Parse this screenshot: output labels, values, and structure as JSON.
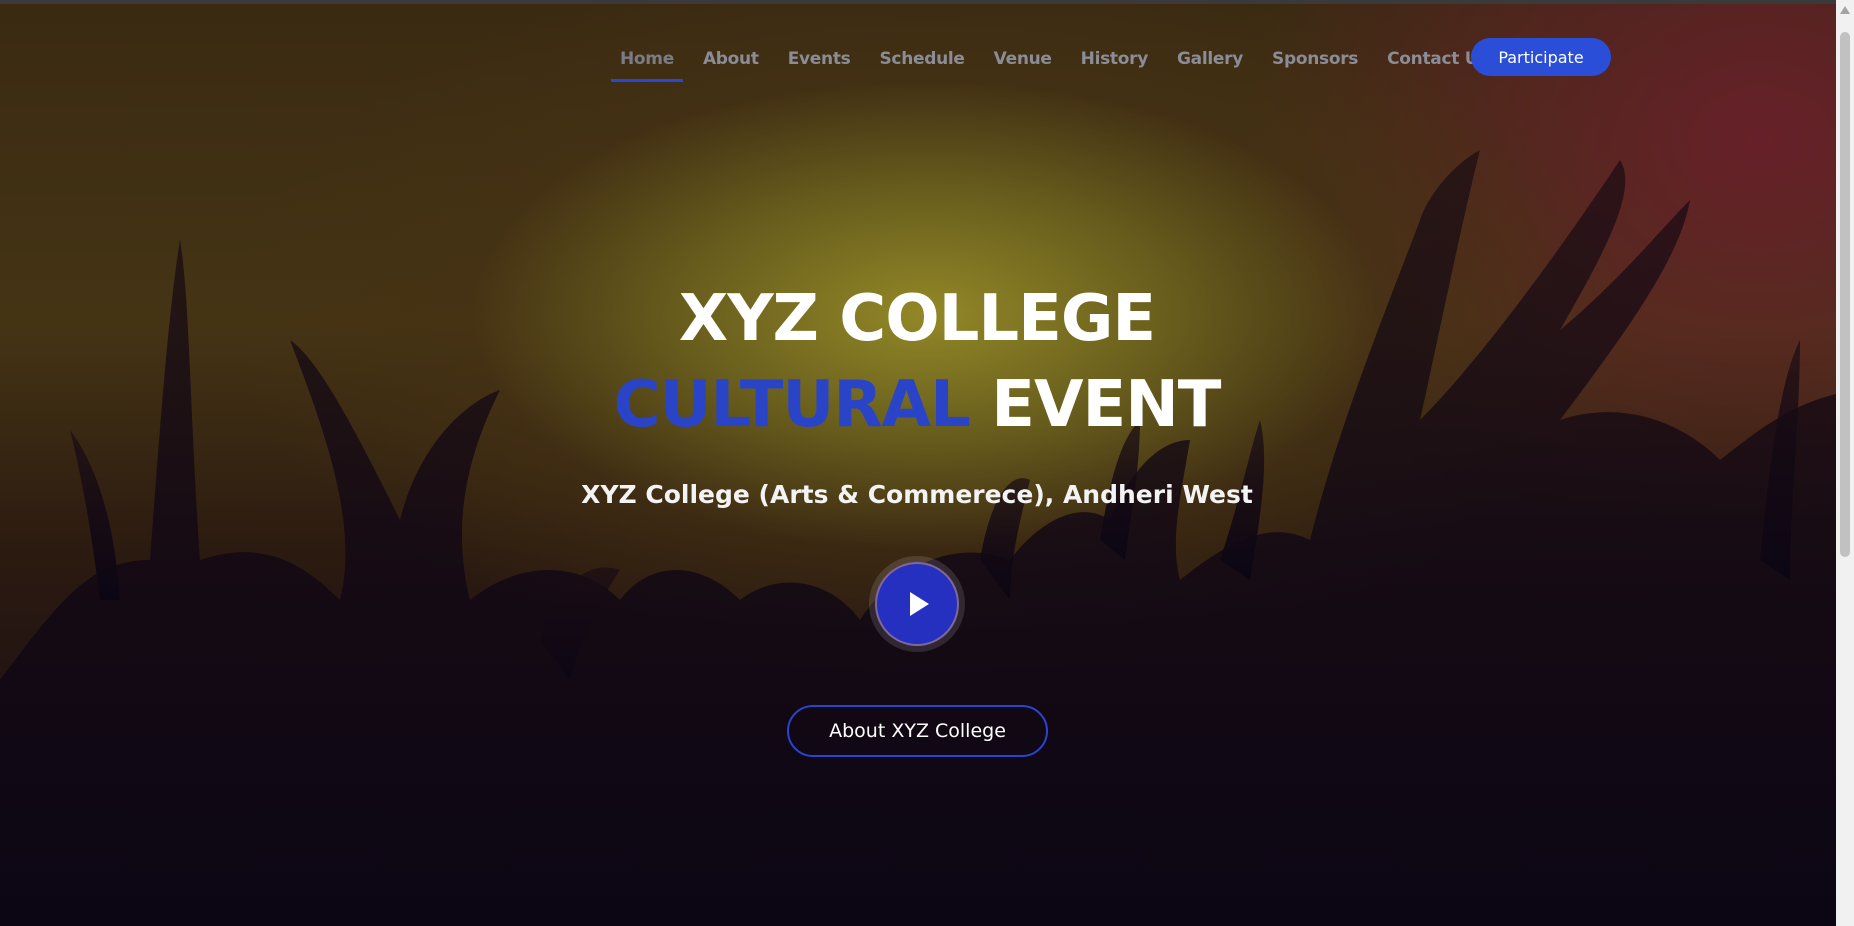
{
  "nav": {
    "items": [
      {
        "label": "Home",
        "active": true
      },
      {
        "label": "About"
      },
      {
        "label": "Events"
      },
      {
        "label": "Schedule"
      },
      {
        "label": "Venue"
      },
      {
        "label": "History"
      },
      {
        "label": "Gallery"
      },
      {
        "label": "Sponsors"
      },
      {
        "label": "Contact Us"
      }
    ],
    "cta_label": "Participate"
  },
  "hero": {
    "title_line1": "XYZ COLLEGE",
    "title_line2_accent": "CULTURAL",
    "title_line2_rest": "EVENT",
    "subtitle": "XYZ College (Arts & Commerece), Andheri West",
    "play_icon": "play-icon",
    "about_button_label": "About XYZ College"
  },
  "colors": {
    "accent": "#2a44c8",
    "button": "#2a4ed8",
    "play_button": "#2630c0",
    "text": "#ffffff",
    "nav_text": "#8a8c96"
  }
}
